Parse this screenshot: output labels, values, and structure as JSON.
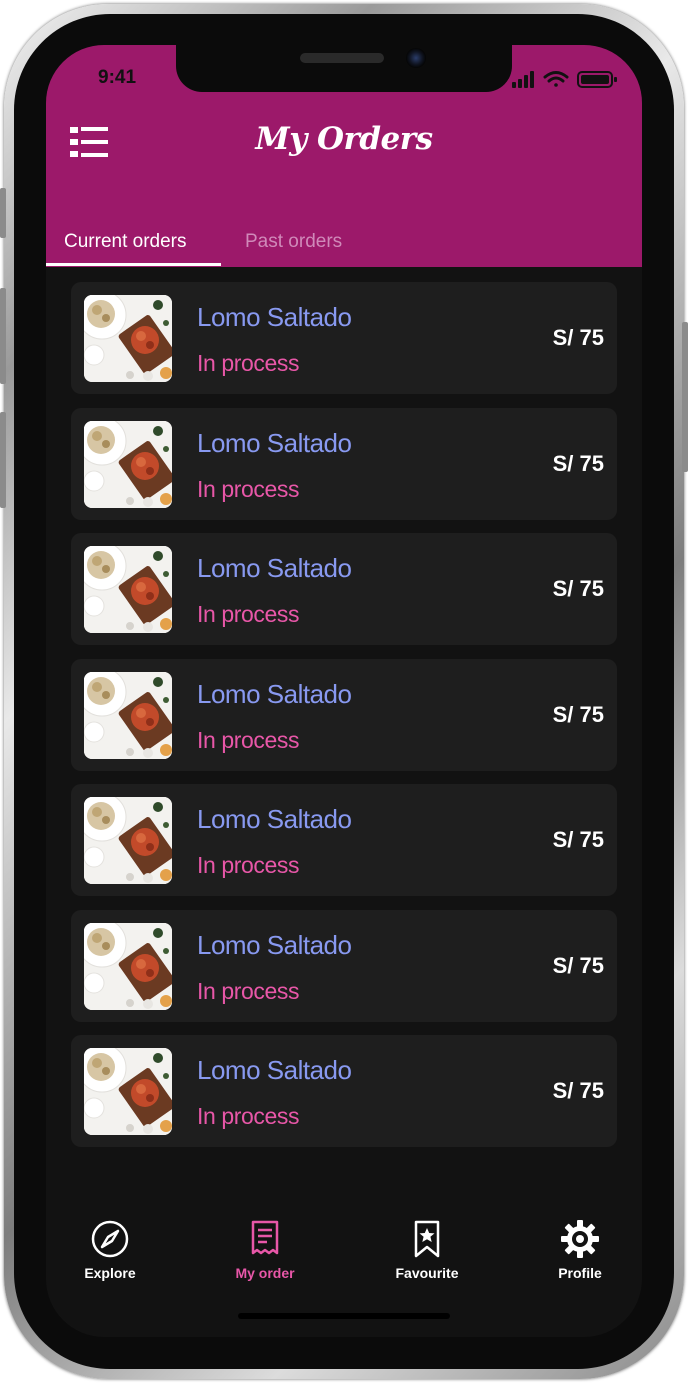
{
  "status_bar": {
    "time": "9:41"
  },
  "header": {
    "title": "My Orders"
  },
  "tabs": [
    {
      "label": "Current orders",
      "active": true
    },
    {
      "label": "Past orders",
      "active": false
    }
  ],
  "orders": [
    {
      "name": "Lomo Saltado",
      "status": "In process",
      "price": "S/ 75"
    },
    {
      "name": "Lomo Saltado",
      "status": "In process",
      "price": "S/ 75"
    },
    {
      "name": "Lomo Saltado",
      "status": "In process",
      "price": "S/ 75"
    },
    {
      "name": "Lomo Saltado",
      "status": "In process",
      "price": "S/ 75"
    },
    {
      "name": "Lomo Saltado",
      "status": "In process",
      "price": "S/ 75"
    },
    {
      "name": "Lomo Saltado",
      "status": "In process",
      "price": "S/ 75"
    },
    {
      "name": "Lomo Saltado",
      "status": "In process",
      "price": "S/ 75"
    }
  ],
  "bottom_nav": [
    {
      "label": "Explore",
      "icon": "compass-icon",
      "active": false
    },
    {
      "label": "My order",
      "icon": "receipt-icon",
      "active": true
    },
    {
      "label": "Favourite",
      "icon": "bookmark-star-icon",
      "active": false
    },
    {
      "label": "Profile",
      "icon": "gear-icon",
      "active": false
    }
  ],
  "colors": {
    "header": "#9c196a",
    "background": "#121212",
    "card": "#1e1e1e",
    "order_name": "#8899f0",
    "order_status": "#e857a8",
    "nav_active": "#e857a8",
    "nav_inactive": "#ffffff"
  }
}
